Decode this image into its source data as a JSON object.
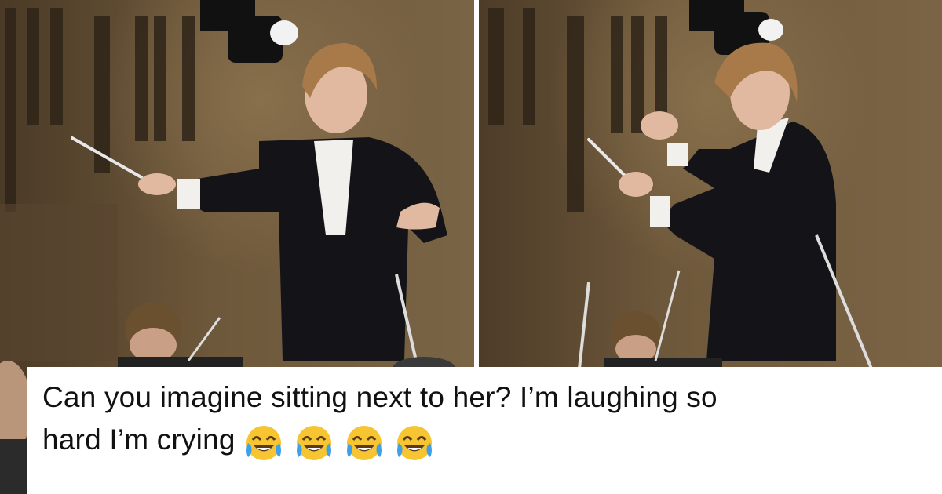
{
  "caption": {
    "line1": "Can you imagine sitting next to her?  I’m laughing so",
    "line2": "hard I’m crying"
  },
  "emojis": [
    {
      "icon": "face-with-tears-of-joy-icon"
    },
    {
      "icon": "face-with-tears-of-joy-icon"
    },
    {
      "icon": "face-with-tears-of-joy-icon"
    },
    {
      "icon": "face-with-tears-of-joy-icon"
    }
  ],
  "colors": {
    "backdrop": "#6b5538",
    "suit": "#141418",
    "shirt": "#f2f0ec",
    "skin": "#e0b9a0",
    "hair": "#a87a4a",
    "caption_bg": "#ffffff",
    "caption_text": "#111111",
    "emoji_face": "#f7c531",
    "emoji_tear": "#3ea0e8"
  }
}
